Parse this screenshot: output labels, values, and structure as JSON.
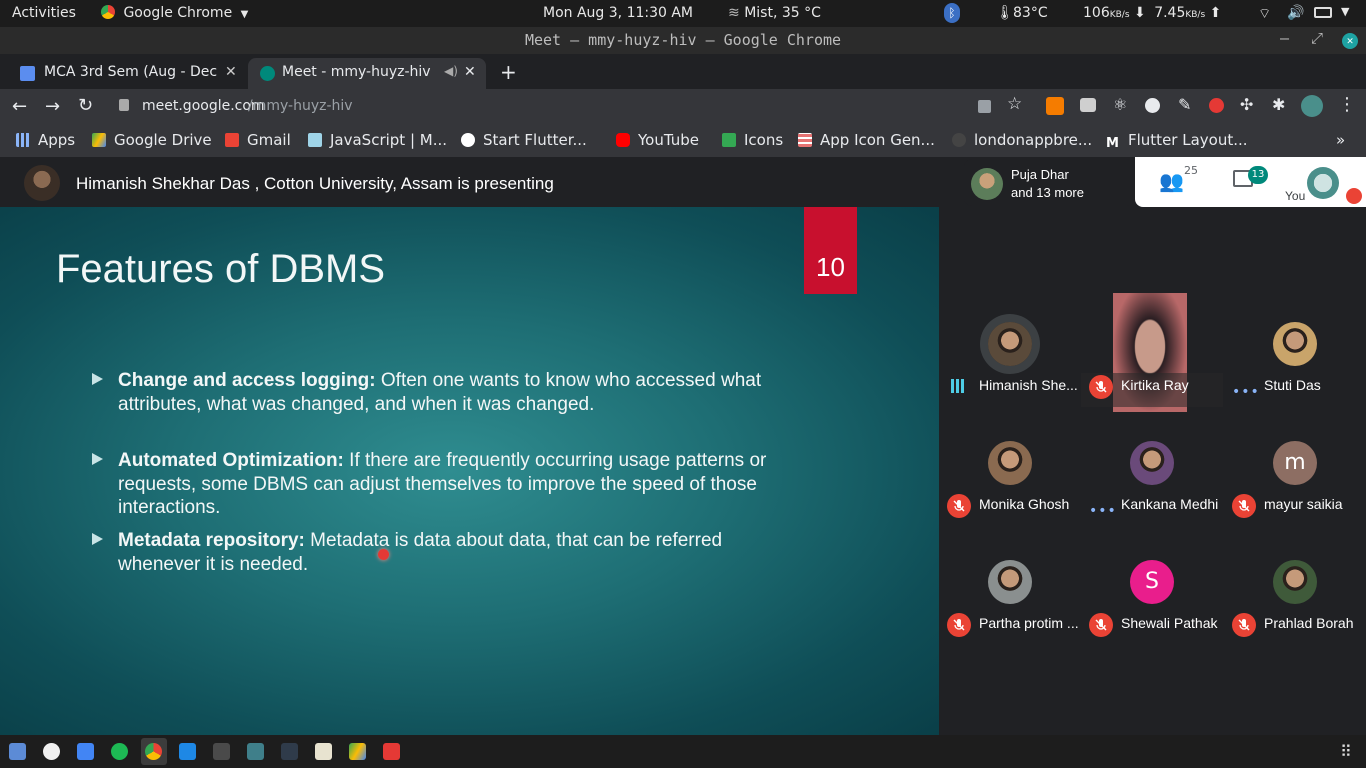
{
  "system": {
    "activities": "Activities",
    "app_name": "Google Chrome",
    "datetime": "Mon Aug  3, 11:30 AM",
    "weather": "Mist, 35 °C",
    "temperature": "83°C",
    "download_value": "106",
    "download_unit": "KB/s",
    "upload_value": "7.45",
    "upload_unit": "KB/s"
  },
  "window": {
    "title": "Meet – mmy-huyz-hiv – Google Chrome"
  },
  "tabs": [
    {
      "label": "MCA 3rd Sem (Aug - Dec"
    },
    {
      "label": "Meet - mmy-huyz-hiv"
    }
  ],
  "address": {
    "domain": "meet.google.com",
    "path": "/mmy-huyz-hiv"
  },
  "bookmarks": [
    "Apps",
    "Google Drive",
    "Gmail",
    "JavaScript | M...",
    "Start Flutter...",
    "YouTube",
    "Icons",
    "App Icon Gen...",
    "londonappbre...",
    "Flutter Layout..."
  ],
  "meet": {
    "presenter_text": "Himanish Shekhar Das , Cotton University, Assam is presenting",
    "pinned_name": "Puja Dhar",
    "pinned_more": "and 13 more",
    "people_count": "25",
    "chat_count": "13",
    "you_label": "You"
  },
  "slide": {
    "title": "Features of DBMS",
    "number": "10",
    "bullets": [
      {
        "bold": "Change and access logging:",
        "text": " Often one wants to know who accessed what attributes, what was changed, and when it was changed."
      },
      {
        "bold": "Automated Optimization:",
        "text": " If there are frequently occurring usage patterns or requests, some DBMS can adjust themselves to improve the speed of those interactions."
      },
      {
        "bold": "Metadata repository:",
        "text": " Metadata is data about data, that can be referred whenever it is needed."
      }
    ]
  },
  "participants": [
    {
      "name": "Himanish She...",
      "status": "speaking",
      "avatar": "photo",
      "color": "#5a4a3a"
    },
    {
      "name": "Kirtika Ray",
      "status": "muted",
      "avatar": "video",
      "color": "#b86868"
    },
    {
      "name": "Stuti Das",
      "status": "dots",
      "avatar": "photo",
      "color": "#c9a46a"
    },
    {
      "name": "Monika Ghosh",
      "status": "muted",
      "avatar": "photo",
      "color": "#8a6a50"
    },
    {
      "name": "Kankana Medhi",
      "status": "dots",
      "avatar": "photo",
      "color": "#6a4a7a"
    },
    {
      "name": "mayur saikia",
      "status": "muted",
      "avatar": "m",
      "color": "#8d6e63"
    },
    {
      "name": "Partha protim ...",
      "status": "muted",
      "avatar": "photo",
      "color": "#8a8f8f"
    },
    {
      "name": "Shewali Pathak",
      "status": "muted",
      "avatar": "S",
      "color": "#e91e8c"
    },
    {
      "name": "Prahlad Borah",
      "status": "muted",
      "avatar": "photo",
      "color": "#3f5a3a"
    }
  ]
}
